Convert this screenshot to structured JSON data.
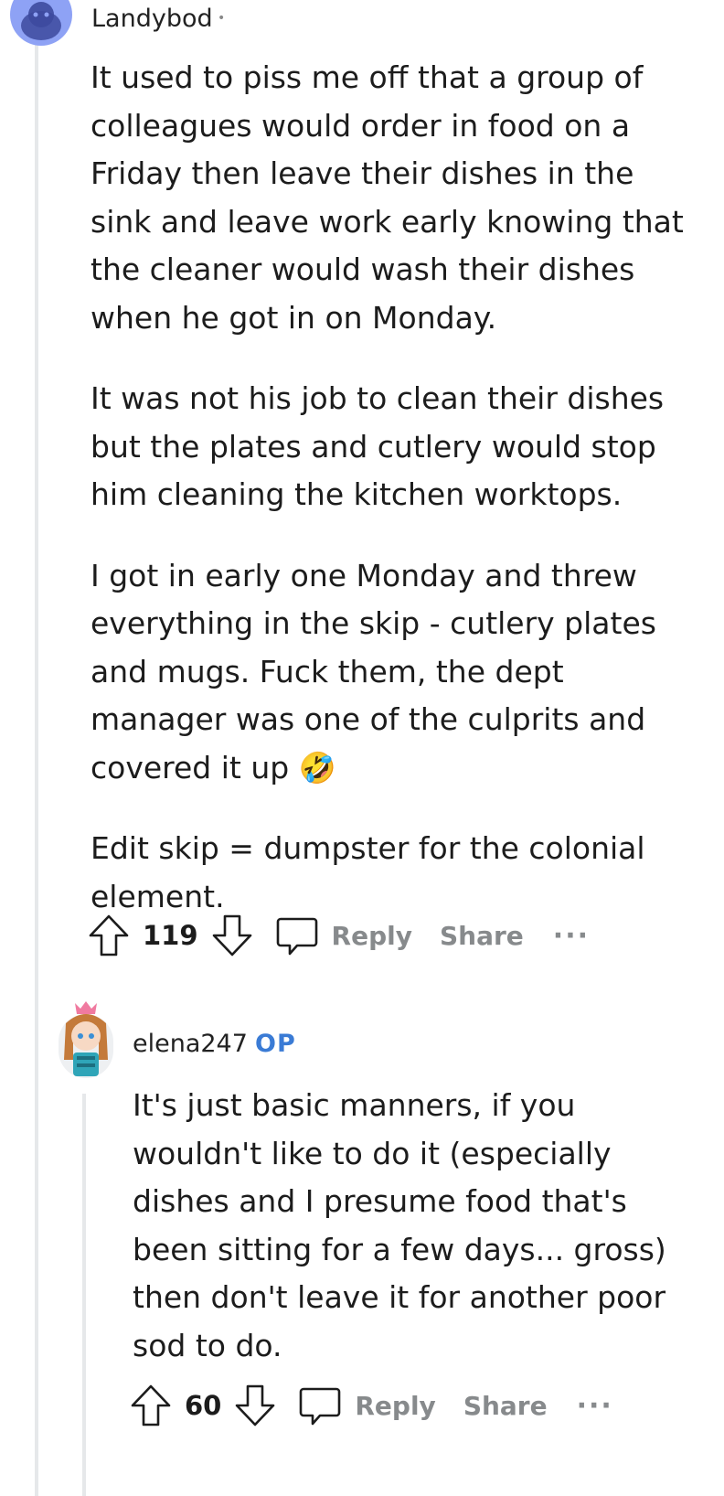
{
  "comments": [
    {
      "username": "Landybod",
      "paragraphs": [
        "It used to piss me off that a group of colleagues would order in food on a Friday then leave their dishes in the sink and leave work early knowing that the cleaner would wash their dishes when he got in on Monday.",
        "It was not his job to clean their dishes but the plates and cutlery would stop him cleaning the kitchen worktops.",
        "I got in early one Monday and threw everything in the skip - cutlery plates and mugs. Fuck them, the dept manager was one of the culprits and covered it up 🤣",
        "Edit skip = dumpster for the colonial element."
      ],
      "score": "119",
      "reply_label": "Reply",
      "share_label": "Share",
      "more_label": "···"
    },
    {
      "username": "elena247",
      "badge": "OP",
      "paragraphs": [
        "It's just basic manners, if you wouldn't like to do it (especially dishes and I presume food that's been sitting for a few days... gross) then don't leave it for another poor sod to do."
      ],
      "score": "60",
      "reply_label": "Reply",
      "share_label": "Share",
      "more_label": "···"
    }
  ],
  "colors": {
    "thread_line": "#e6e8ea",
    "op_badge": "#3a7bd5",
    "muted_action": "#878a8c",
    "avatar_blue": "#8ea2f5"
  },
  "icons": [
    "reddit-snoo-icon",
    "upvote-arrow-icon",
    "downvote-arrow-icon",
    "comment-bubble-icon"
  ]
}
